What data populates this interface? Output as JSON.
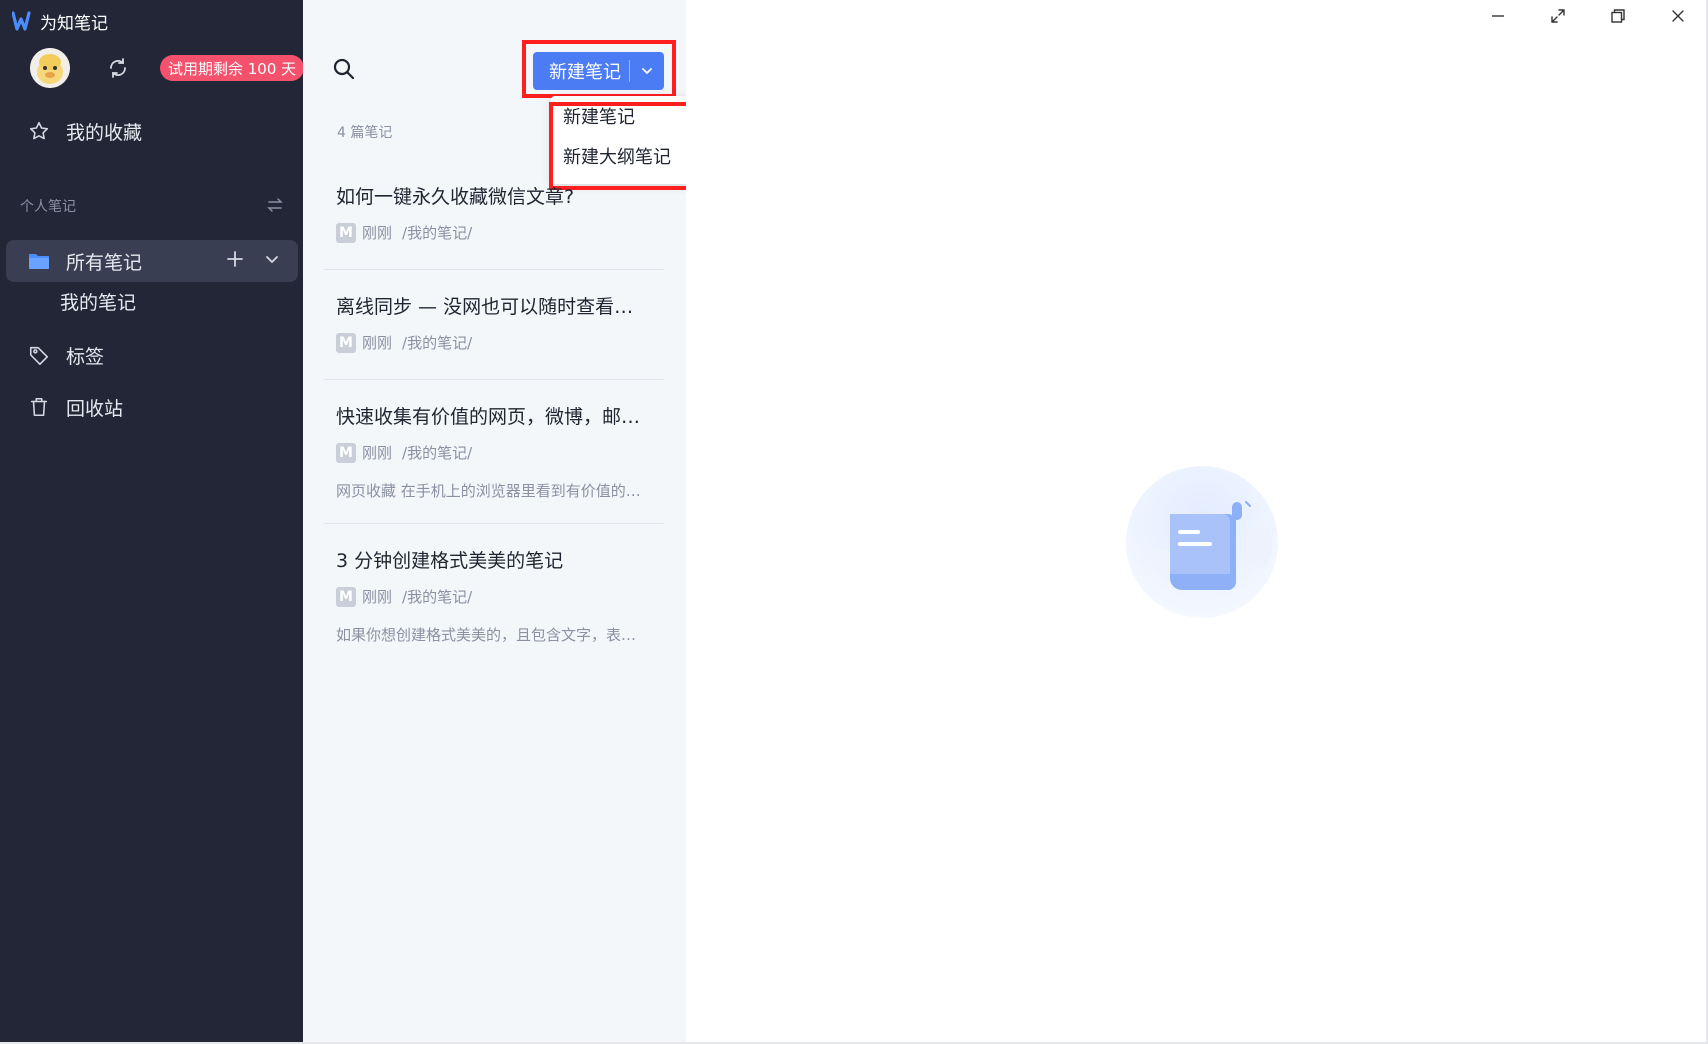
{
  "app": {
    "title": "为知笔记"
  },
  "header": {
    "trial_badge": "试用期剩余 100 天"
  },
  "sidebar": {
    "favorites": "我的收藏",
    "section_label": "个人笔记",
    "all_notes": "所有笔记",
    "my_notes": "我的笔记",
    "tags": "标签",
    "trash": "回收站"
  },
  "list": {
    "new_note_label": "新建笔记",
    "dropdown": [
      "新建笔记",
      "新建大纲笔记"
    ],
    "count_text": "4 篇笔记",
    "notes": [
      {
        "title": "如何一键永久收藏微信文章?",
        "time": "刚刚",
        "path": "/我的笔记/",
        "summary": ""
      },
      {
        "title": "离线同步 — 没网也可以随时查看…",
        "time": "刚刚",
        "path": "/我的笔记/",
        "summary": ""
      },
      {
        "title": "快速收集有价值的网页，微博，邮…",
        "time": "刚刚",
        "path": "/我的笔记/",
        "summary": "网页收藏 在手机上的浏览器里看到有价值的…"
      },
      {
        "title": "3 分钟创建格式美美的笔记",
        "time": "刚刚",
        "path": "/我的笔记/",
        "summary": "如果你想创建格式美美的，且包含文字，表…"
      }
    ]
  },
  "colors": {
    "sidebar_bg": "#232637",
    "accent": "#4b7cf4",
    "badge": "#f4516c",
    "highlight": "#ff1f1f"
  },
  "icons": [
    "app-logo-icon",
    "sync-icon",
    "star-icon",
    "folder-icon",
    "plus-icon",
    "chevron-down-icon",
    "tag-icon",
    "trash-icon",
    "swap-icon",
    "search-icon",
    "minimize-icon",
    "expand-icon",
    "restore-icon",
    "close-icon"
  ]
}
